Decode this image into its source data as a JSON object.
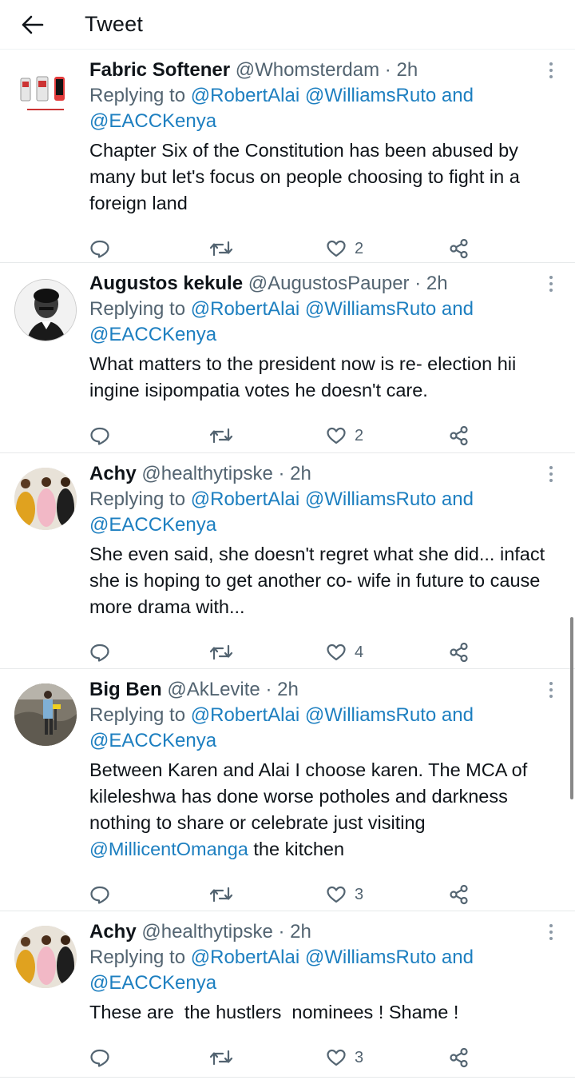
{
  "header": {
    "title": "Tweet",
    "back_icon": "arrow-left-icon"
  },
  "reply_prefix": "Replying to",
  "tweets": [
    {
      "name": "Fabric Softener",
      "handle": "@Whomsterdam",
      "sep": "·",
      "time": "2h",
      "mentions": [
        "@RobertAlai",
        "@WilliamsRuto",
        "@EACCKenya"
      ],
      "and": "and",
      "text": "Chapter Six of the Constitution has been abused by many but let's focus on people choosing to fight in a foreign land",
      "likes": "2"
    },
    {
      "name": "Augustos kekule",
      "handle": "@AugustosPauper",
      "sep": "·",
      "time": "2h",
      "mentions": [
        "@RobertAlai",
        "@WilliamsRuto",
        "@EACCKenya"
      ],
      "and": "and",
      "text": "What matters to the president now is re- election hii ingine isipompatia votes he doesn't care.",
      "likes": "2"
    },
    {
      "name": "Achy",
      "handle": "@healthytipske",
      "sep": "·",
      "time": "2h",
      "mentions": [
        "@RobertAlai",
        "@WilliamsRuto",
        "@EACCKenya"
      ],
      "and": "and",
      "text": "She even said, she doesn't regret what she did... infact she is hoping to get another co- wife in future to cause more drama with...",
      "likes": "4"
    },
    {
      "name": "Big Ben",
      "handle": "@AkLevite",
      "sep": "·",
      "time": "2h",
      "mentions": [
        "@RobertAlai",
        "@WilliamsRuto",
        "@EACCKenya"
      ],
      "and": "and",
      "text_before": "Between Karen and Alai I choose karen. The MCA of kileleshwa has done worse potholes and darkness nothing to share or celebrate just visiting ",
      "text_mention": "@MillicentOmanga",
      "text_after": " the kitchen",
      "likes": "3"
    },
    {
      "name": "Achy",
      "handle": "@healthytipske",
      "sep": "·",
      "time": "2h",
      "mentions": [
        "@RobertAlai",
        "@WilliamsRuto",
        "@EACCKenya"
      ],
      "and": "and",
      "text": "These are  the hustlers  nominees ! Shame !",
      "likes": "3"
    }
  ],
  "colors": {
    "link": "#1d7fc0",
    "muted": "#536471",
    "text": "#0f1419"
  }
}
